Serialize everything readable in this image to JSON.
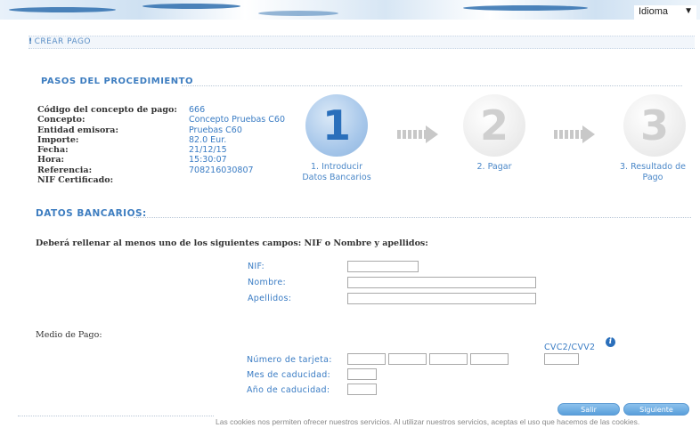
{
  "header": {
    "language_label": "Idioma",
    "language_arrow": "▼"
  },
  "breadcrumb": {
    "mark": "!",
    "label": "CREAR PAGO"
  },
  "procedure": {
    "title": "PASOS DEL PROCEDIMIENTO",
    "fields": [
      {
        "label": "Código del concepto de pago:",
        "value": "666"
      },
      {
        "label": "Concepto:",
        "value": "Concepto Pruebas C60"
      },
      {
        "label": "Entidad emisora:",
        "value": "Pruebas C60"
      },
      {
        "label": "Importe:",
        "value": "82.0 Eur."
      },
      {
        "label": "Fecha:",
        "value": "21/12/15"
      },
      {
        "label": "Hora:",
        "value": "15:30:07"
      },
      {
        "label": "Referencia:",
        "value": "708216030807"
      },
      {
        "label": "NIF Certificado:",
        "value": ""
      }
    ],
    "steps": [
      {
        "number": "1",
        "label_line1": "1. Introducir",
        "label_line2": "Datos Bancarios"
      },
      {
        "number": "2",
        "label_line1": "2. Pagar",
        "label_line2": ""
      },
      {
        "number": "3",
        "label_line1": "3. Resultado de",
        "label_line2": "Pago"
      }
    ]
  },
  "bank_data": {
    "title": "DATOS BANCARIOS:",
    "instruction": "Deberá rellenar al menos uno de los siguientes campos: NIF o Nombre y apellidos:",
    "nif_label": "NIF:",
    "nombre_label": "Nombre:",
    "apellidos_label": "Apellidos:",
    "payment_method_label": "Medio de Pago:",
    "card_number_label": "Número de tarjeta:",
    "expiry_month_label": "Mes de caducidad:",
    "expiry_year_label": "Año de caducidad:",
    "cvc_label": "CVC2/CVV2",
    "info_icon": "i"
  },
  "buttons": {
    "exit": "Salir",
    "next": "Siguiente"
  },
  "cookies_notice": "Las cookies nos permiten ofrecer nuestros servicios. Al utilizar nuestros servicios, aceptas el uso que hacemos de las cookies.",
  "colors": {
    "accent": "#3a7cc4",
    "button": "#5a9fdb"
  }
}
